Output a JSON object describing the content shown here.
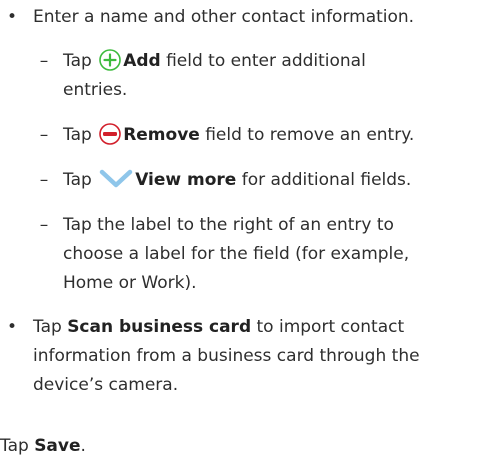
{
  "bullet_symbol": "•",
  "dash_symbol": "–",
  "item1": {
    "text": "Enter a name and other contact information."
  },
  "sub_add": {
    "pre": "Tap ",
    "icon": "add-circle-icon",
    "bold": "Add",
    "post1": " field to enter additional",
    "post2": "entries."
  },
  "sub_remove": {
    "pre": "Tap ",
    "icon": "remove-circle-icon",
    "bold": "Remove",
    "post": " field to remove an entry."
  },
  "sub_view_more": {
    "pre": "Tap ",
    "icon": "chevron-down-icon",
    "bold": "View more",
    "post": " for additional fields."
  },
  "sub_label": {
    "line1": "Tap the label to the right of an entry to",
    "line2": "choose a label for the field (for example,",
    "line3": "Home or Work)."
  },
  "item2": {
    "pre": "Tap ",
    "bold": "Scan business card",
    "post1": " to import contact",
    "line2": "information from a business card through the",
    "line3": "device’s camera."
  },
  "final": {
    "pre": "Tap ",
    "bold": "Save",
    "post": "."
  },
  "colors": {
    "text": "#2e2e2e",
    "add_icon": "#3dbb3d",
    "remove_icon": "#d21f2b",
    "chevron_icon": "#8fc6ea"
  }
}
